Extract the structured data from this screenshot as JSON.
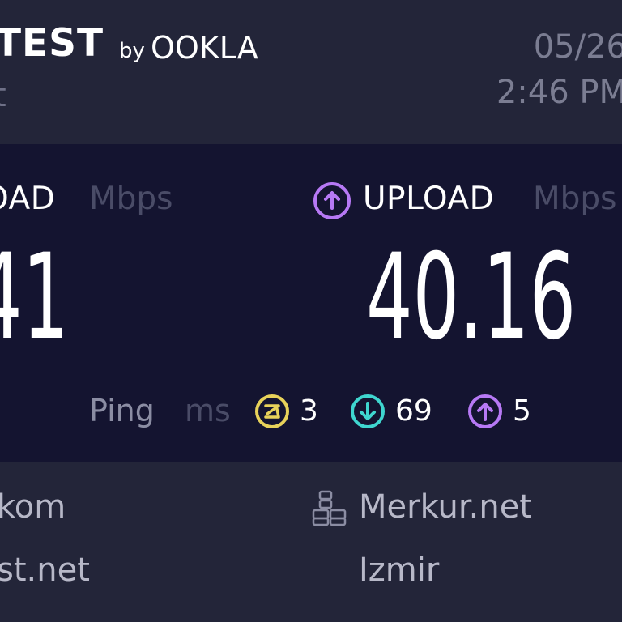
{
  "header": {
    "brand_wordmark": "TEST",
    "brand_by": "by",
    "brand_company": "OOKLA",
    "sub_text": "t",
    "date": "05/26",
    "time": "2:46 PM"
  },
  "results": {
    "download": {
      "label": "OAD",
      "unit": "Mbps",
      "value": "41"
    },
    "upload": {
      "label": "UPLOAD",
      "unit": "Mbps",
      "value": "40.16",
      "icon": "arrow-up-circle-icon"
    },
    "ping": {
      "label": "Ping",
      "unit": "ms",
      "idle": {
        "value": "3",
        "icon": "idle-latency-icon",
        "color": "#e8d25a"
      },
      "download": {
        "value": "69",
        "icon": "arrow-down-circle-icon",
        "color": "#3fd6cf"
      },
      "upload": {
        "value": "5",
        "icon": "arrow-up-circle-icon",
        "color": "#b779f5"
      }
    }
  },
  "connection": {
    "isp_name": "kom",
    "isp_host": "st.net",
    "server_icon": "server-icon",
    "server_name": "Merkur.net",
    "server_location": "Izmir"
  },
  "colors": {
    "background": "#232539",
    "panel": "#141430",
    "upload_accent": "#b779f5",
    "download_accent": "#3fd6cf",
    "idle_accent": "#e8d25a"
  }
}
